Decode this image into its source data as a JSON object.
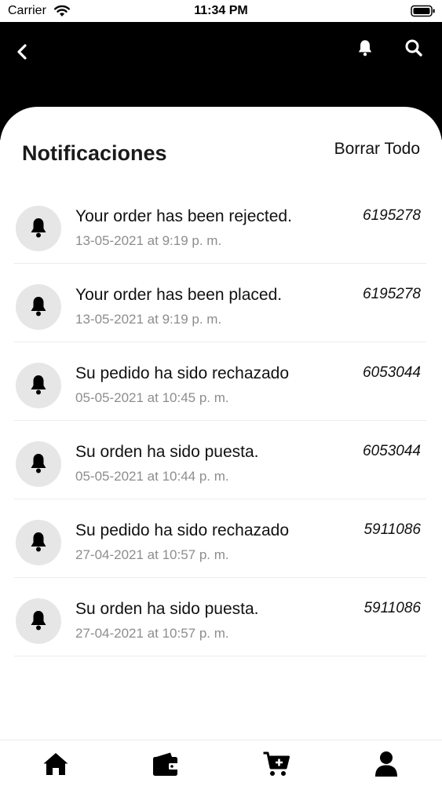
{
  "status_bar": {
    "carrier": "Carrier",
    "time": "11:34 PM"
  },
  "header": {
    "back_icon": "chevron-left-icon",
    "bell_icon": "bell-icon",
    "search_icon": "search-icon",
    "background": "#000000"
  },
  "page": {
    "title": "Notificaciones",
    "clear_all_label": "Borrar Todo"
  },
  "notifications": [
    {
      "title": "Your order has been rejected.",
      "date": "13-05-2021 at 9:19 p. m.",
      "order": "6195278"
    },
    {
      "title": "Your order has been placed.",
      "date": "13-05-2021 at 9:19 p. m.",
      "order": "6195278"
    },
    {
      "title": "Su pedido ha sido rechazado",
      "date": "05-05-2021 at 10:45 p. m.",
      "order": "6053044"
    },
    {
      "title": "Su orden ha sido puesta.",
      "date": "05-05-2021 at 10:44 p. m.",
      "order": "6053044"
    },
    {
      "title": "Su pedido ha sido rechazado",
      "date": "27-04-2021 at 10:57 p. m.",
      "order": "5911086"
    },
    {
      "title": "Su orden ha sido puesta.",
      "date": "27-04-2021 at 10:57 p. m.",
      "order": "5911086"
    }
  ],
  "bottom_nav": {
    "items": [
      "home-icon",
      "wallet-icon",
      "cart-add-icon",
      "user-icon"
    ]
  }
}
